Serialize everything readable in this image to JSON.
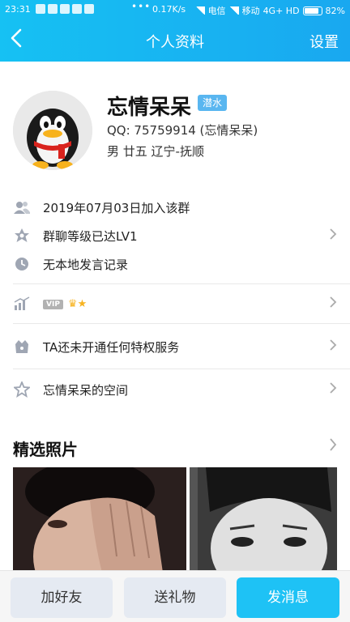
{
  "status_bar": {
    "time": "23:31",
    "speed": "0.17K/s",
    "carrier1": "电信",
    "carrier2": "移动",
    "network": "4G+ HD",
    "battery": "82%"
  },
  "header": {
    "title": "个人资料",
    "back_icon": "chevron-left-icon",
    "settings_label": "设置"
  },
  "profile": {
    "name": "忘情呆呆",
    "badge": "潜水",
    "qq": "QQ: 75759914 (忘情呆呆)",
    "info": "男  廿五  辽宁-抚顺"
  },
  "rows": [
    {
      "icon": "members-icon",
      "text": "2019年07月03日加入该群",
      "chevron": false
    },
    {
      "icon": "level-star-icon",
      "text": "群聊等级已达LV1",
      "chevron": true
    },
    {
      "icon": "clock-icon",
      "text": "无本地发言记录",
      "chevron": false
    },
    {
      "icon": "growth-chart-icon",
      "text": "VIP",
      "chevron": true
    },
    {
      "icon": "privilege-bag-icon",
      "text": "TA还未开通任何特权服务",
      "chevron": true
    },
    {
      "icon": "space-star-icon",
      "text": "忘情呆呆的空间",
      "chevron": true
    }
  ],
  "photos_section": {
    "title": "精选照片"
  },
  "actions": {
    "add_friend": "加好友",
    "send_gift": "送礼物",
    "send_message": "发消息"
  },
  "colors": {
    "header": "#19b4f2",
    "primary_button": "#1ec2f5",
    "badge": "#59b6f0"
  }
}
